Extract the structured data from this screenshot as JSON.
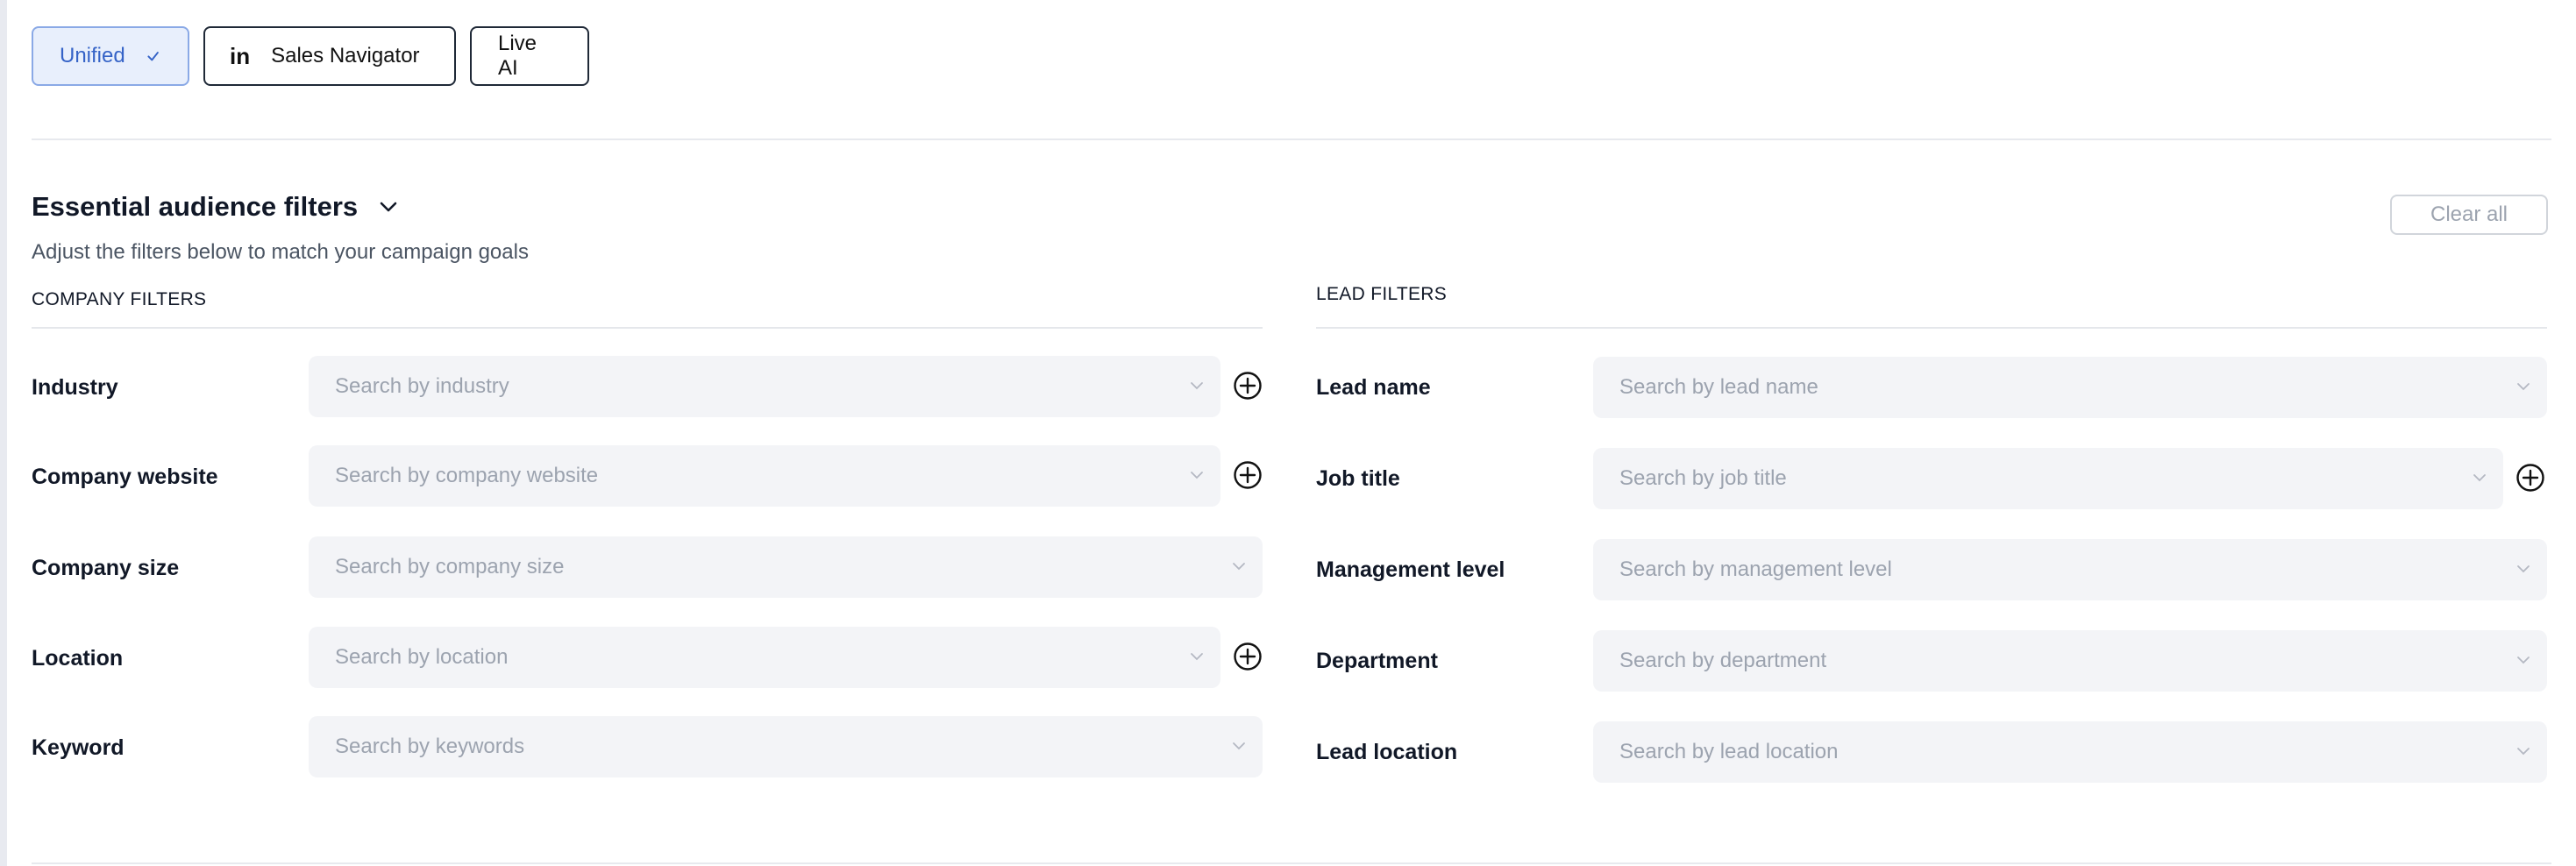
{
  "tabs": [
    {
      "label": "Unified",
      "active": true
    },
    {
      "label": "Sales Navigator",
      "icon": "linkedin-icon",
      "icon_text": "in"
    },
    {
      "label": "Live AI"
    }
  ],
  "header": {
    "title": "Essential audience filters",
    "subtitle": "Adjust the filters below to match your campaign goals",
    "clear_label": "Clear all"
  },
  "company": {
    "section_title": "COMPANY FILTERS",
    "filters": [
      {
        "label": "Industry",
        "placeholder": "Search by industry",
        "add": true
      },
      {
        "label": "Company website",
        "placeholder": "Search by company website",
        "add": true
      },
      {
        "label": "Company size",
        "placeholder": "Search by company size",
        "add": false
      },
      {
        "label": "Location",
        "placeholder": "Search by location",
        "add": true
      },
      {
        "label": "Keyword",
        "placeholder": "Search by keywords",
        "add": false
      }
    ]
  },
  "lead": {
    "section_title": "LEAD FILTERS",
    "filters": [
      {
        "label": "Lead name",
        "placeholder": "Search by lead name",
        "add": false
      },
      {
        "label": "Job title",
        "placeholder": "Search by job title",
        "add": true
      },
      {
        "label": "Management level",
        "placeholder": "Search by management level",
        "add": false
      },
      {
        "label": "Department",
        "placeholder": "Search by department",
        "add": false
      },
      {
        "label": "Lead location",
        "placeholder": "Search by lead location",
        "add": false
      }
    ]
  },
  "colors": {
    "accent": "#3563c7",
    "accent_bg": "#e8effc",
    "field_bg": "#f3f4f7",
    "placeholder": "#9ca3af"
  }
}
